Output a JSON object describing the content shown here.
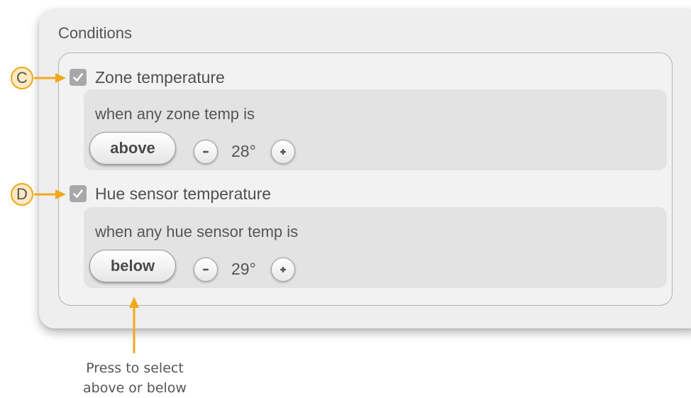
{
  "panel": {
    "title": "Conditions"
  },
  "conditions": [
    {
      "label": "Zone temperature",
      "checked": true,
      "description": "when any zone temp is",
      "mode": "above",
      "value": "28°",
      "marker": "C"
    },
    {
      "label": "Hue sensor temperature",
      "checked": true,
      "description": "when any hue sensor temp is",
      "mode": "below",
      "value": "29°",
      "marker": "D"
    }
  ],
  "callout": {
    "line1": "Press to select",
    "line2": "above or below"
  },
  "colors": {
    "accent": "#f0a81a",
    "panel_bg": "#eeeeee",
    "detail_bg": "#e3e3e3",
    "checkbox": "#a8a8a8"
  },
  "icons": {
    "checkbox": "check-icon",
    "decrement": "minus-icon",
    "increment": "plus-icon"
  }
}
